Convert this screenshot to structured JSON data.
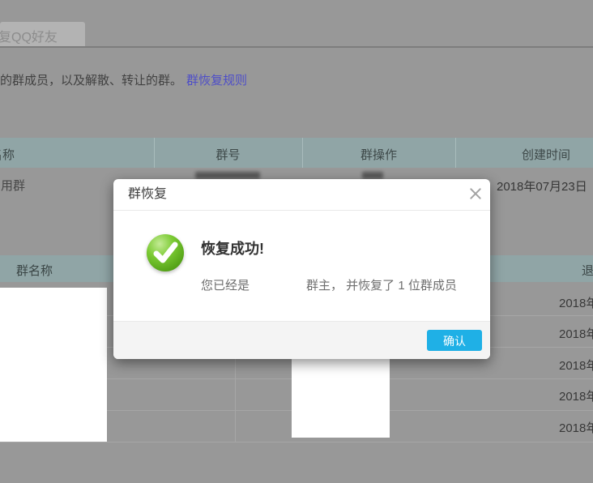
{
  "page": {
    "tab_label": "恢复QQ好友",
    "description_tail": "的群成员，以及解散、转让的群。",
    "rules_link": "群恢复规则"
  },
  "group_table": {
    "headers": [
      "群名称",
      "群号",
      "群操作",
      "创建时间"
    ],
    "row": {
      "name": "用群",
      "created_time": "2018年07月23日"
    }
  },
  "member_table": {
    "headers": [
      "群名称",
      "退出时间"
    ],
    "rows": [
      {
        "quit_time": "2018年"
      },
      {
        "quit_time": "2018年"
      },
      {
        "quit_time": "2018年"
      },
      {
        "quit_time": "2018年"
      },
      {
        "quit_time": "2018年"
      }
    ]
  },
  "dialog": {
    "title": "群恢复",
    "result_title": "恢复成功!",
    "message_prefix": "您已经是",
    "message_suffix": "群主， 并恢复了 1 位群成员",
    "confirm_label": "确认"
  },
  "colors": {
    "accent_blue": "#1fb0e6",
    "table_header_teal": "#90a5a6",
    "success_green": "#6dbf2a",
    "link_blue": "#4e4ec8",
    "dim_background": "#989898"
  }
}
